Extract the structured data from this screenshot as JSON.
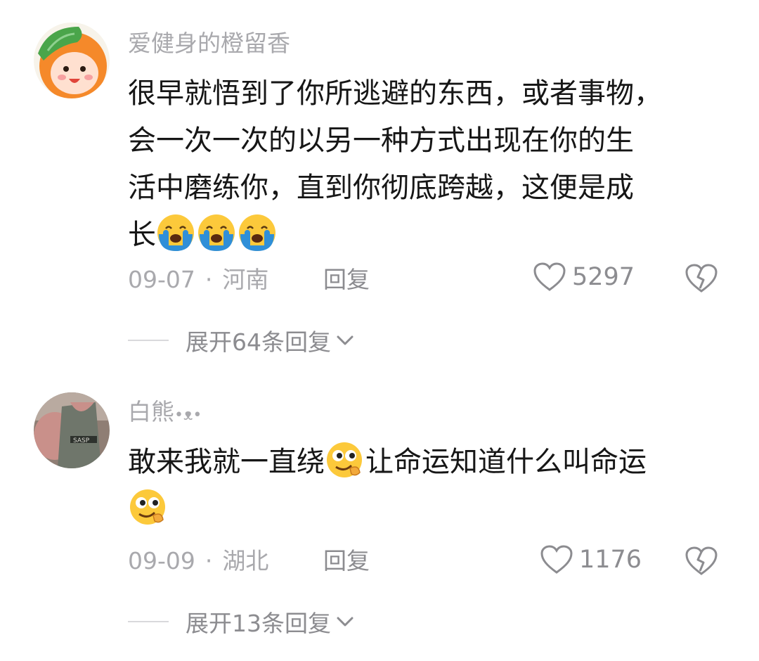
{
  "comments": [
    {
      "username": "爱健身的橙留香",
      "avatar_icon": "orange-cartoon-avatar-icon",
      "lines": [
        "很早就悟到了你所逃避的东西，或者事物，",
        "会一次一次的以另一种方式出现在你的生",
        "活中磨练你，直到你彻底跨越，这便是成",
        "长"
      ],
      "emojis": [
        "crying-emoji-icon",
        "crying-emoji-icon",
        "crying-emoji-icon"
      ],
      "date": "09-07",
      "location": "河南",
      "reply_label": "回复",
      "likes": "5297",
      "expand_label": "展开64条回复"
    },
    {
      "username": "白熊",
      "username_suffix": "•ᴥ•",
      "avatar_icon": "man-photo-avatar",
      "line1_before": "敢来我就一直绕",
      "line1_after": "让命运知道什么叫命运",
      "emojis": [
        "smirk-emoji-icon",
        "smirk-emoji-icon"
      ],
      "date": "09-09",
      "location": "湖北",
      "reply_label": "回复",
      "likes": "1176",
      "expand_label": "展开13条回复"
    }
  ],
  "colors": {
    "meta_gray": "#a9a9ad",
    "text_dark": "#161616",
    "emoji_yellow": "#fcc93b",
    "tear_blue": "#2f8fd8"
  }
}
